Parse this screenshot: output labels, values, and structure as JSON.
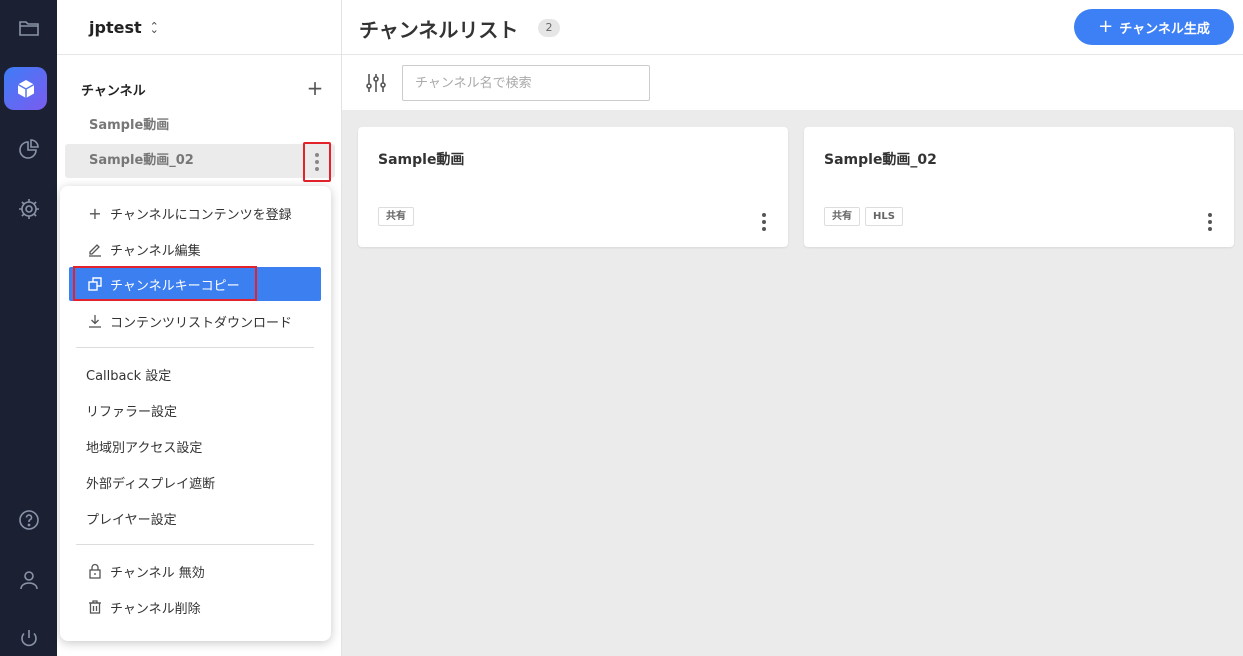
{
  "rail": {
    "icons": [
      "folder-icon",
      "cube-icon",
      "pie-chart-icon",
      "gear-icon",
      "help-icon",
      "user-icon",
      "power-icon"
    ]
  },
  "sidebar": {
    "project_name": "jptest",
    "heading": "チャンネル",
    "add_label": "+",
    "items": [
      {
        "label": "Sample動画"
      },
      {
        "label": "Sample動画_02"
      }
    ]
  },
  "menu": {
    "items": [
      {
        "label": "チャンネルにコンテンツを登録",
        "icon": "plus-icon"
      },
      {
        "label": "チャンネル編集",
        "icon": "edit-icon"
      },
      {
        "label": "チャンネルキーコピー",
        "icon": "copy-icon"
      },
      {
        "label": "コンテンツリストダウンロード",
        "icon": "download-icon"
      },
      {
        "label": "Callback 設定"
      },
      {
        "label": "リファラー設定"
      },
      {
        "label": "地域別アクセス設定"
      },
      {
        "label": "外部ディスプレイ遮断"
      },
      {
        "label": "プレイヤー設定"
      },
      {
        "label": "チャンネル 無効",
        "icon": "lock-icon"
      },
      {
        "label": "チャンネル削除",
        "icon": "trash-icon"
      }
    ]
  },
  "header": {
    "title": "チャンネルリスト",
    "count": "2",
    "create_button": "チャンネル生成"
  },
  "search": {
    "placeholder": "チャンネル名で検索"
  },
  "cards": [
    {
      "title": "Sample動画",
      "tags": [
        "共有"
      ]
    },
    {
      "title": "Sample動画_02",
      "tags": [
        "共有",
        "HLS"
      ]
    }
  ],
  "colors": {
    "accent": "#3d7ff5",
    "rail_bg": "#1b2133",
    "highlight_red": "#e3232c"
  }
}
